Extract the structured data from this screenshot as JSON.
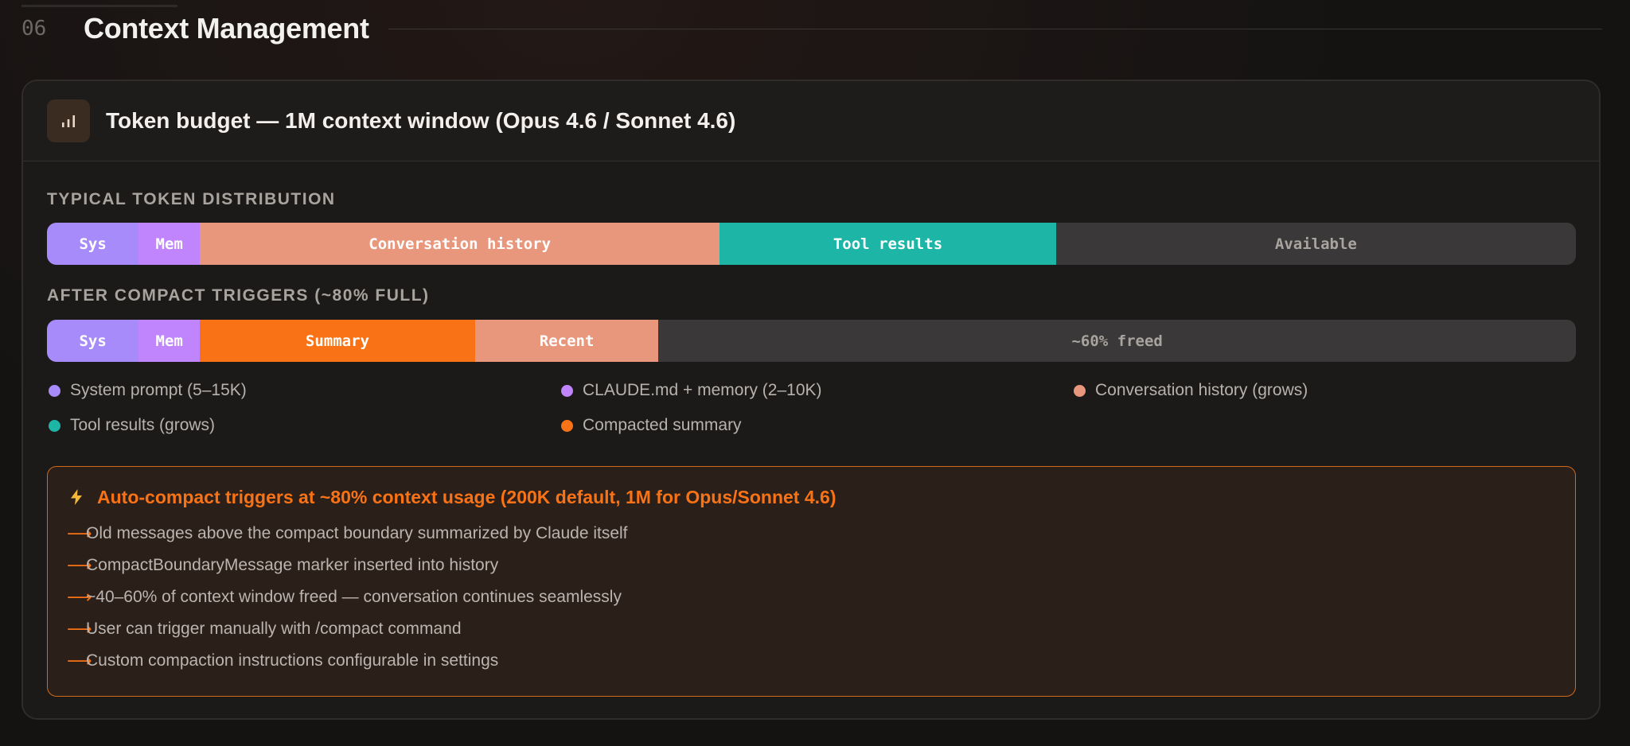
{
  "section": {
    "number": "06",
    "title": "Context Management"
  },
  "card": {
    "title": "Token budget — 1M context window (Opus 4.6 / Sonnet 4.6)",
    "icon": "bar-chart-icon"
  },
  "distribution": {
    "typical_label": "Typical token distribution",
    "typical_segments": [
      {
        "label": "Sys",
        "fraction": 0.06,
        "color": "#a78bfa"
      },
      {
        "label": "Mem",
        "fraction": 0.04,
        "color": "#c084fc"
      },
      {
        "label": "Conversation history",
        "fraction": 0.34,
        "color": "#e8977c"
      },
      {
        "label": "Tool results",
        "fraction": 0.22,
        "color": "#1db5a6"
      },
      {
        "label": "Available",
        "fraction": 0.34,
        "color": "#3a3838"
      }
    ],
    "after_label": "After compact triggers (~80% full)",
    "after_segments": [
      {
        "label": "Sys",
        "fraction": 0.06,
        "color": "#a78bfa"
      },
      {
        "label": "Mem",
        "fraction": 0.04,
        "color": "#c084fc"
      },
      {
        "label": "Summary",
        "fraction": 0.18,
        "color": "#f97316"
      },
      {
        "label": "Recent",
        "fraction": 0.12,
        "color": "#e8977c"
      },
      {
        "label": "~60% freed",
        "fraction": 0.6,
        "color": "#3a3838"
      }
    ]
  },
  "legend": [
    {
      "label": "System prompt (5–15K)",
      "color": "#a78bfa"
    },
    {
      "label": "CLAUDE.md + memory (2–10K)",
      "color": "#c084fc"
    },
    {
      "label": "Conversation history (grows)",
      "color": "#e8977c"
    },
    {
      "label": "Tool results (grows)",
      "color": "#1db5a6"
    },
    {
      "label": "Compacted summary",
      "color": "#f97316"
    }
  ],
  "callout": {
    "title": "Auto-compact triggers at ~80% context usage (200K default, 1M for Opus/Sonnet 4.6)",
    "arrow": "⟶",
    "items": [
      "Old messages above the compact boundary summarized by Claude itself",
      "CompactBoundaryMessage marker inserted into history",
      "~40–60% of context window freed — conversation continues seamlessly",
      "User can trigger manually with /compact command",
      "Custom compaction instructions configurable in settings"
    ]
  }
}
